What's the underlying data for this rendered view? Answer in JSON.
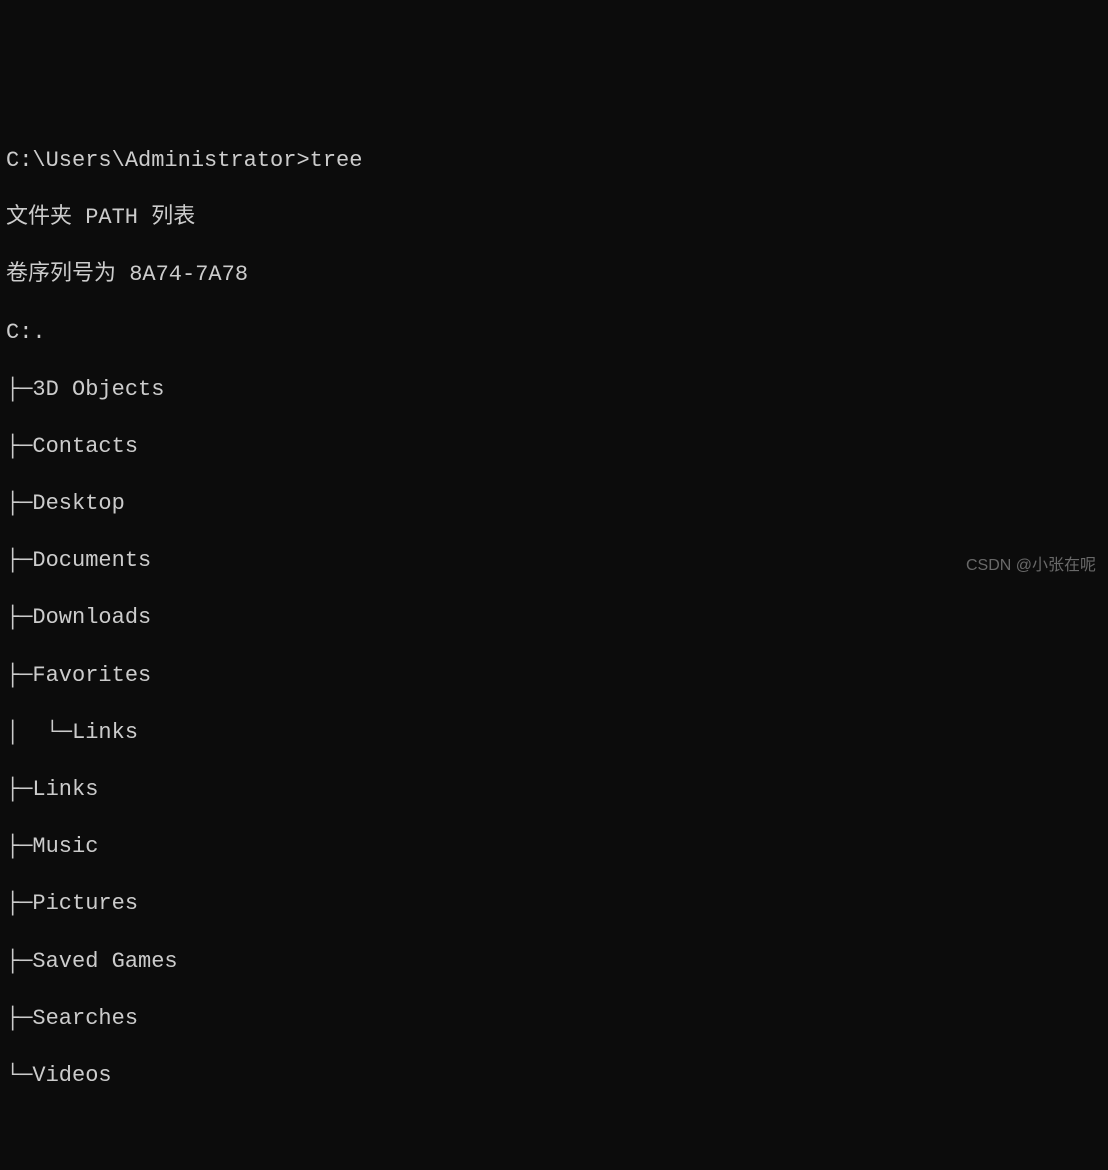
{
  "terminal": {
    "prompt_line": "C:\\Users\\Administrator>tree",
    "header1": "文件夹 PATH 列表",
    "header2": "卷序列号为 8A74-7A78",
    "root": "C:.",
    "tree": [
      "├─3D Objects",
      "├─Contacts",
      "├─Desktop",
      "├─Documents",
      "├─Downloads",
      "├─Favorites",
      "│  └─Links",
      "├─Links",
      "├─Music",
      "├─Pictures",
      "├─Saved Games",
      "├─Searches",
      "└─Videos"
    ]
  },
  "watermark": "CSDN @小张在呢"
}
